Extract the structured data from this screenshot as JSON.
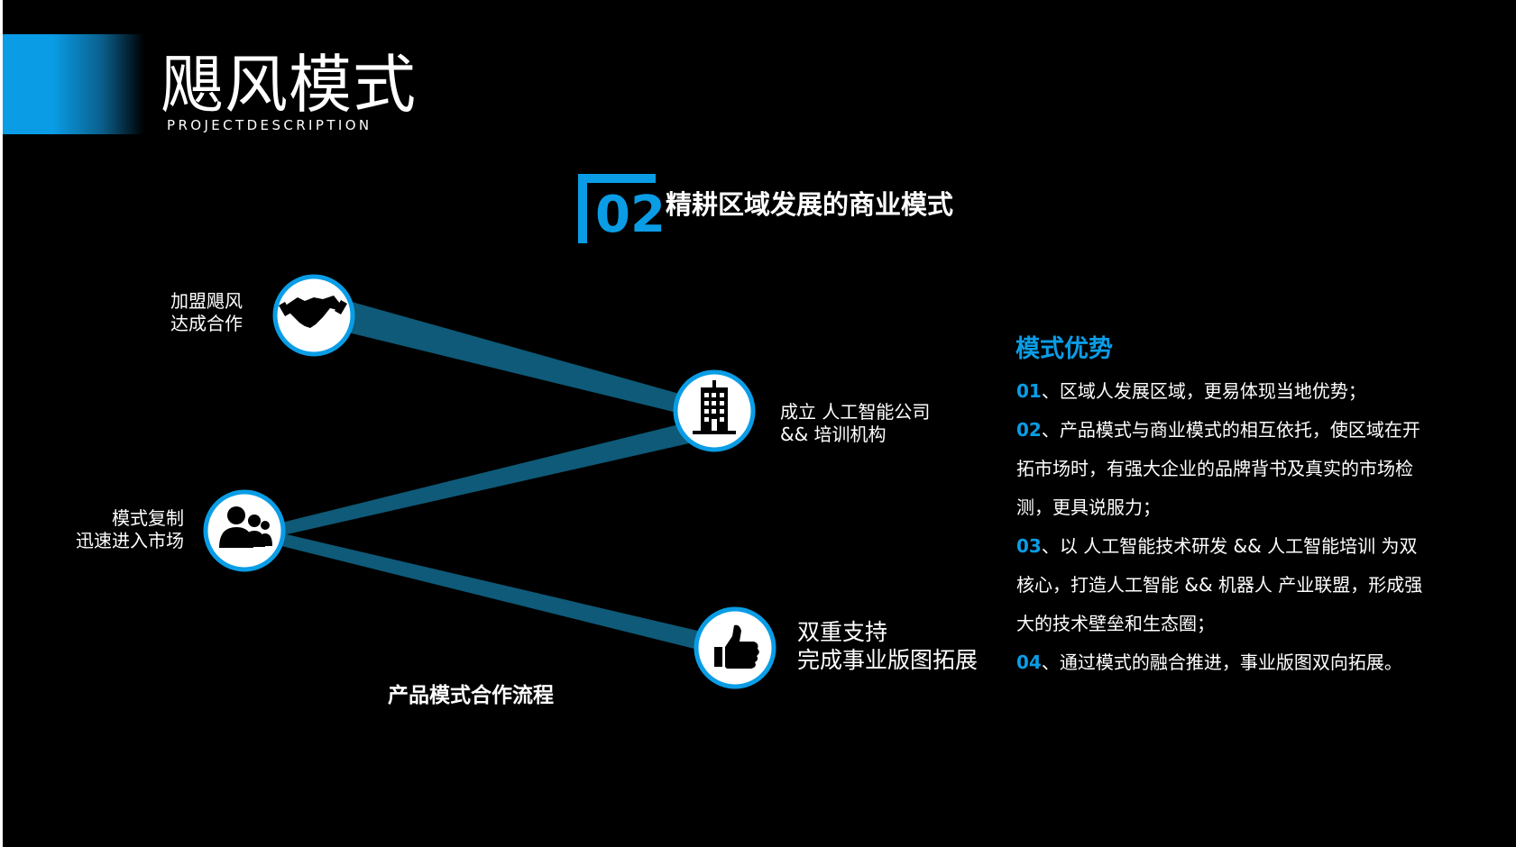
{
  "header": {
    "title": "飓风模式",
    "subtitle": "PROJECTDESCRIPTION"
  },
  "section": {
    "number": "02",
    "title": "精耕区域发展的商业模式"
  },
  "diagram": {
    "nodes": [
      {
        "icon": "handshake-icon",
        "label_lines": [
          "加盟飓风",
          "达成合作"
        ]
      },
      {
        "icon": "building-icon",
        "label_lines": [
          "成立 人工智能公司",
          "&&  培训机构"
        ]
      },
      {
        "icon": "people-group-icon",
        "label_lines": [
          "模式复制",
          "迅速进入市场"
        ]
      },
      {
        "icon": "thumbs-up-icon",
        "label_lines": [
          "双重支持",
          "完成事业版图拓展"
        ]
      }
    ],
    "caption": "产品模式合作流程"
  },
  "advantages": {
    "heading": "模式优势",
    "lines": [
      {
        "num": "01",
        "text": "、区域人发展区域，更易体现当地优势；"
      },
      {
        "num": "02",
        "text": "、产品模式与商业模式的相互依托，使区域在开"
      },
      {
        "num": "",
        "text": "拓市场时，有强大企业的品牌背书及真实的市场检"
      },
      {
        "num": "",
        "text": "测，更具说服力；"
      },
      {
        "num": "03",
        "text": "、以 人工智能技术研发 &&  人工智能培训  为双"
      },
      {
        "num": "",
        "text": "核心，打造人工智能 && 机器人 产业联盟，形成强"
      },
      {
        "num": "",
        "text": "大的技术壁垒和生态圈；"
      },
      {
        "num": "04",
        "text": "、通过模式的融合推进，事业版图双向拓展。"
      }
    ]
  },
  "colors": {
    "accent": "#0a9de6",
    "beam": "#0e5a78",
    "background": "#000000"
  }
}
